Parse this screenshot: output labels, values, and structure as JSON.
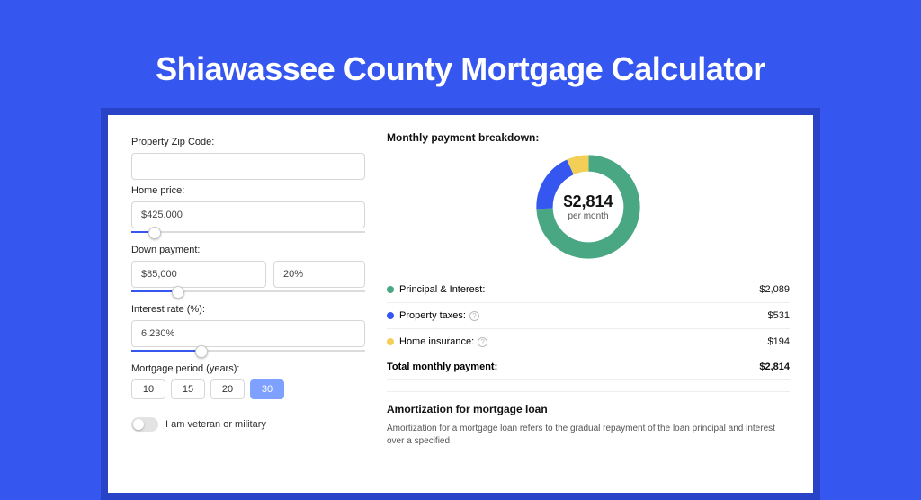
{
  "title": "Shiawassee County Mortgage Calculator",
  "left": {
    "zip_label": "Property Zip Code:",
    "zip_value": "",
    "home_label": "Home price:",
    "home_value": "$425,000",
    "home_slider_pct": 10,
    "down_label": "Down payment:",
    "down_value": "$85,000",
    "down_pct_value": "20%",
    "down_slider_pct": 20,
    "rate_label": "Interest rate (%):",
    "rate_value": "6.230%",
    "rate_slider_pct": 30,
    "period_label": "Mortgage period (years):",
    "periods": [
      "10",
      "15",
      "20",
      "30"
    ],
    "period_selected": "30",
    "veteran_label": "I am veteran or military"
  },
  "right": {
    "breakdown_title": "Monthly payment breakdown:",
    "center_amount": "$2,814",
    "center_sub": "per month",
    "items": [
      {
        "label": "Principal & Interest:",
        "value": "$2,089",
        "color": "green",
        "help": false
      },
      {
        "label": "Property taxes:",
        "value": "$531",
        "color": "blue",
        "help": true
      },
      {
        "label": "Home insurance:",
        "value": "$194",
        "color": "yellow",
        "help": true
      }
    ],
    "total_label": "Total monthly payment:",
    "total_value": "$2,814",
    "amort_title": "Amortization for mortgage loan",
    "amort_text": "Amortization for a mortgage loan refers to the gradual repayment of the loan principal and interest over a specified"
  },
  "chart_data": {
    "type": "pie",
    "title": "Monthly payment breakdown",
    "series": [
      {
        "name": "Principal & Interest",
        "value": 2089,
        "color": "#4aa783"
      },
      {
        "name": "Property taxes",
        "value": 531,
        "color": "#3557f0"
      },
      {
        "name": "Home insurance",
        "value": 194,
        "color": "#f3cf57"
      }
    ],
    "total": 2814,
    "center_label": "$2,814 per month"
  }
}
